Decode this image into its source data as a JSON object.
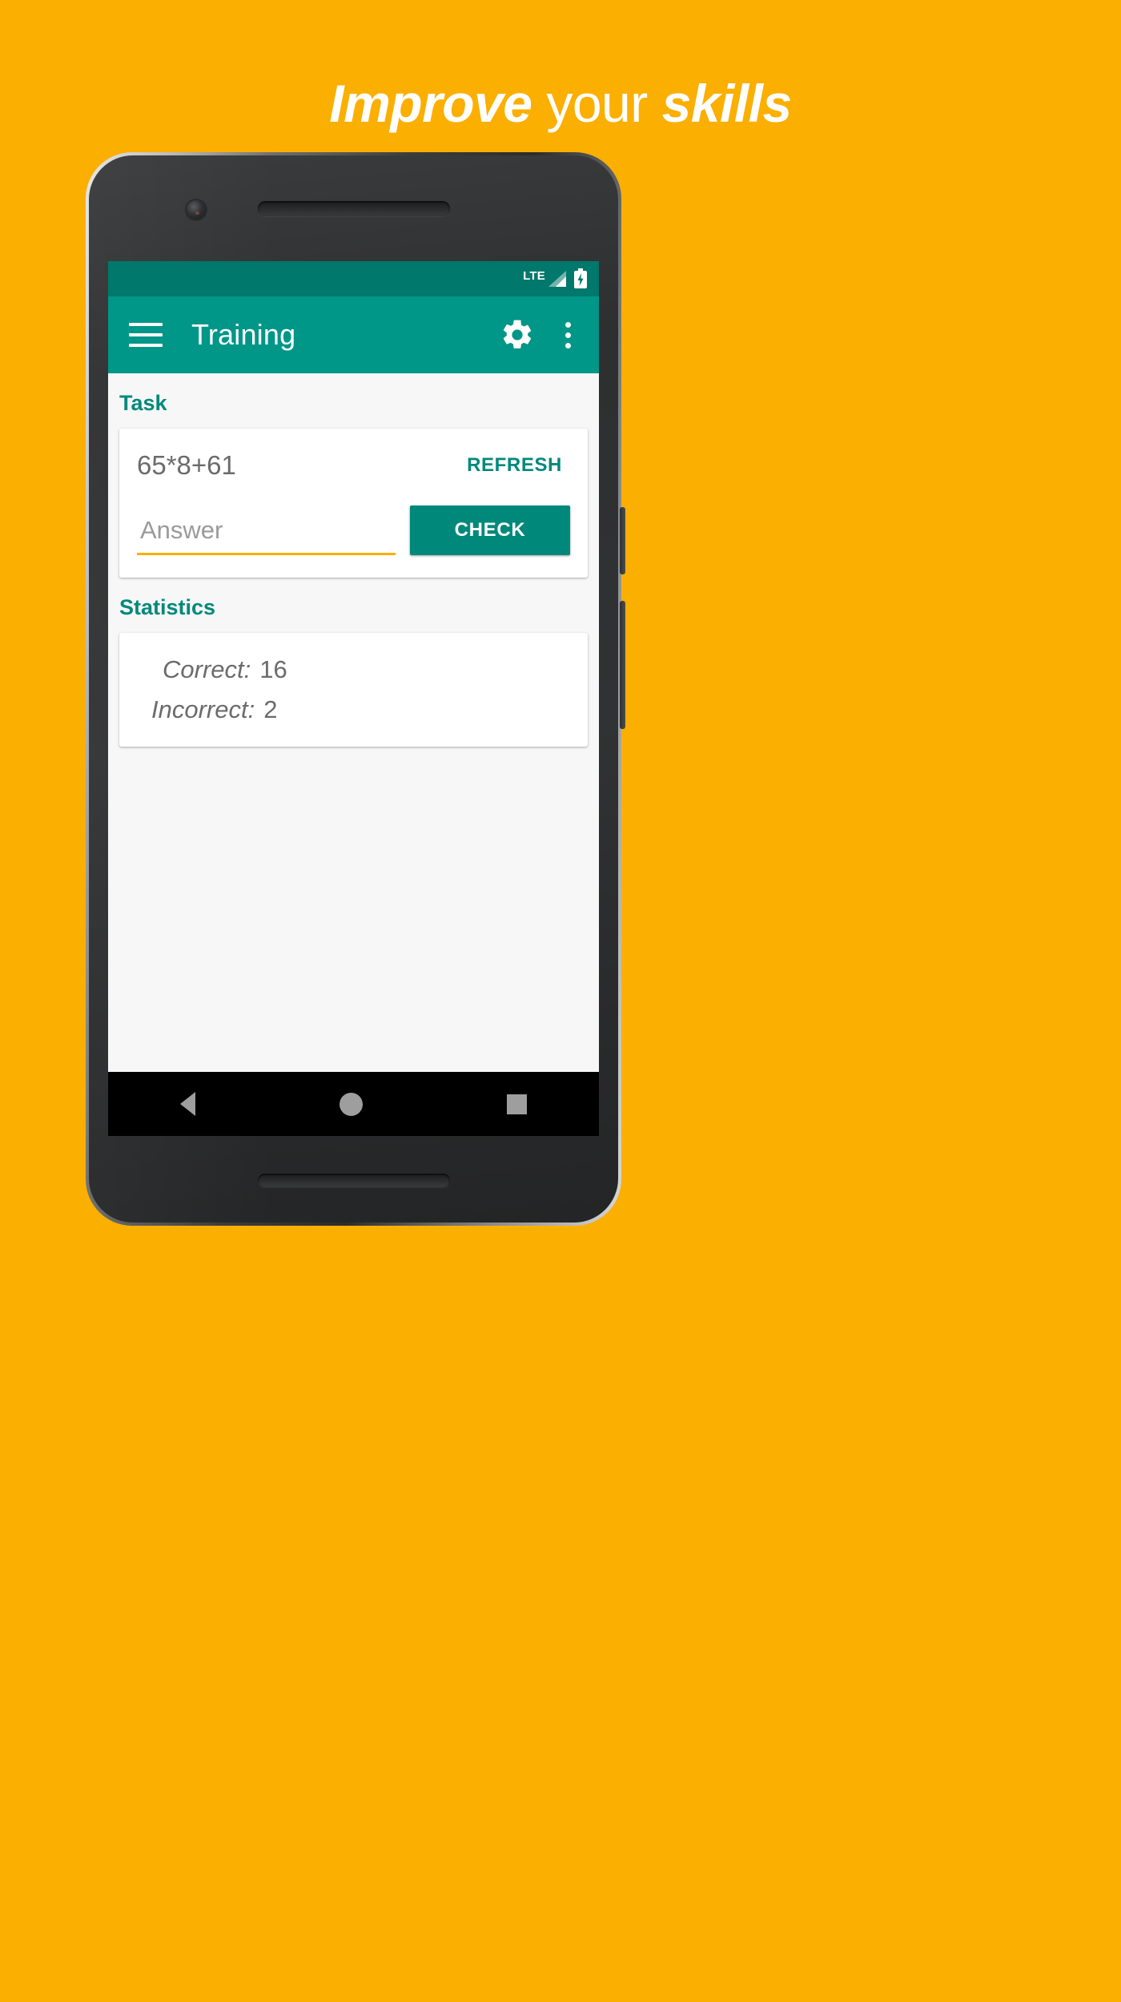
{
  "promo": {
    "headline_part1": "Improve",
    "headline_part2": " your ",
    "headline_part3": "skills",
    "background_color": "#FBAF00",
    "headline_color": "#FFFFFF"
  },
  "phone": {
    "statusbar": {
      "network_label": "LTE",
      "signal_icon": "signal-bars-icon",
      "battery_icon": "battery-charging-icon",
      "background_color": "#00786B"
    },
    "appbar": {
      "menu_icon": "hamburger-menu-icon",
      "title": "Training",
      "settings_icon": "gear-icon",
      "overflow_icon": "more-vertical-icon",
      "background_color": "#009688"
    },
    "content": {
      "task_section": {
        "label": "Task",
        "expression": "65*8+61",
        "refresh_label": "REFRESH",
        "answer_placeholder": "Answer",
        "answer_value": "",
        "check_label": "CHECK",
        "accent_color": "#00897B",
        "underline_color": "#FBAF00"
      },
      "statistics_section": {
        "label": "Statistics",
        "rows": [
          {
            "key": "Correct:",
            "value": "16"
          },
          {
            "key": "Incorrect:",
            "value": "2"
          }
        ]
      }
    },
    "navbar": {
      "back_icon": "nav-back-icon",
      "home_icon": "nav-home-icon",
      "recents_icon": "nav-recents-icon"
    }
  }
}
